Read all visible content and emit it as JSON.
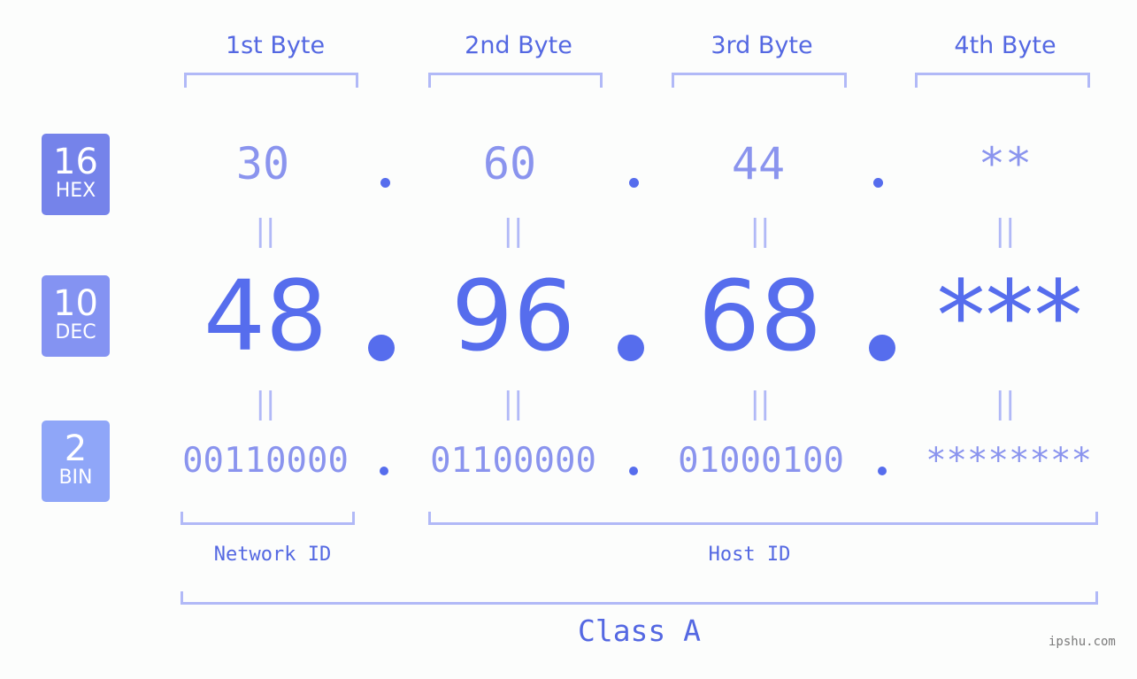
{
  "bytes": [
    {
      "title": "1st Byte",
      "hex": "30",
      "dec": "48",
      "bin": "00110000"
    },
    {
      "title": "2nd Byte",
      "hex": "60",
      "dec": "96",
      "bin": "01100000"
    },
    {
      "title": "3rd Byte",
      "hex": "44",
      "dec": "68",
      "bin": "01000100"
    },
    {
      "title": "4th Byte",
      "hex": "**",
      "dec": "***",
      "bin": "********"
    }
  ],
  "bases": [
    {
      "number": "16",
      "label": "HEX",
      "color": "#7583ea"
    },
    {
      "number": "10",
      "label": "DEC",
      "color": "#8493f2"
    },
    {
      "number": "2",
      "label": "BIN",
      "color": "#8fa6f8"
    }
  ],
  "separator": ".",
  "equals_symbol": "||",
  "segments": {
    "network_label": "Network ID",
    "host_label": "Host ID",
    "class_label": "Class A"
  },
  "watermark": "ipshu.com",
  "colors": {
    "accent": "#566ded",
    "light": "#8a94ee",
    "bracket": "#b1b9f7",
    "background": "#fcfdfc"
  }
}
